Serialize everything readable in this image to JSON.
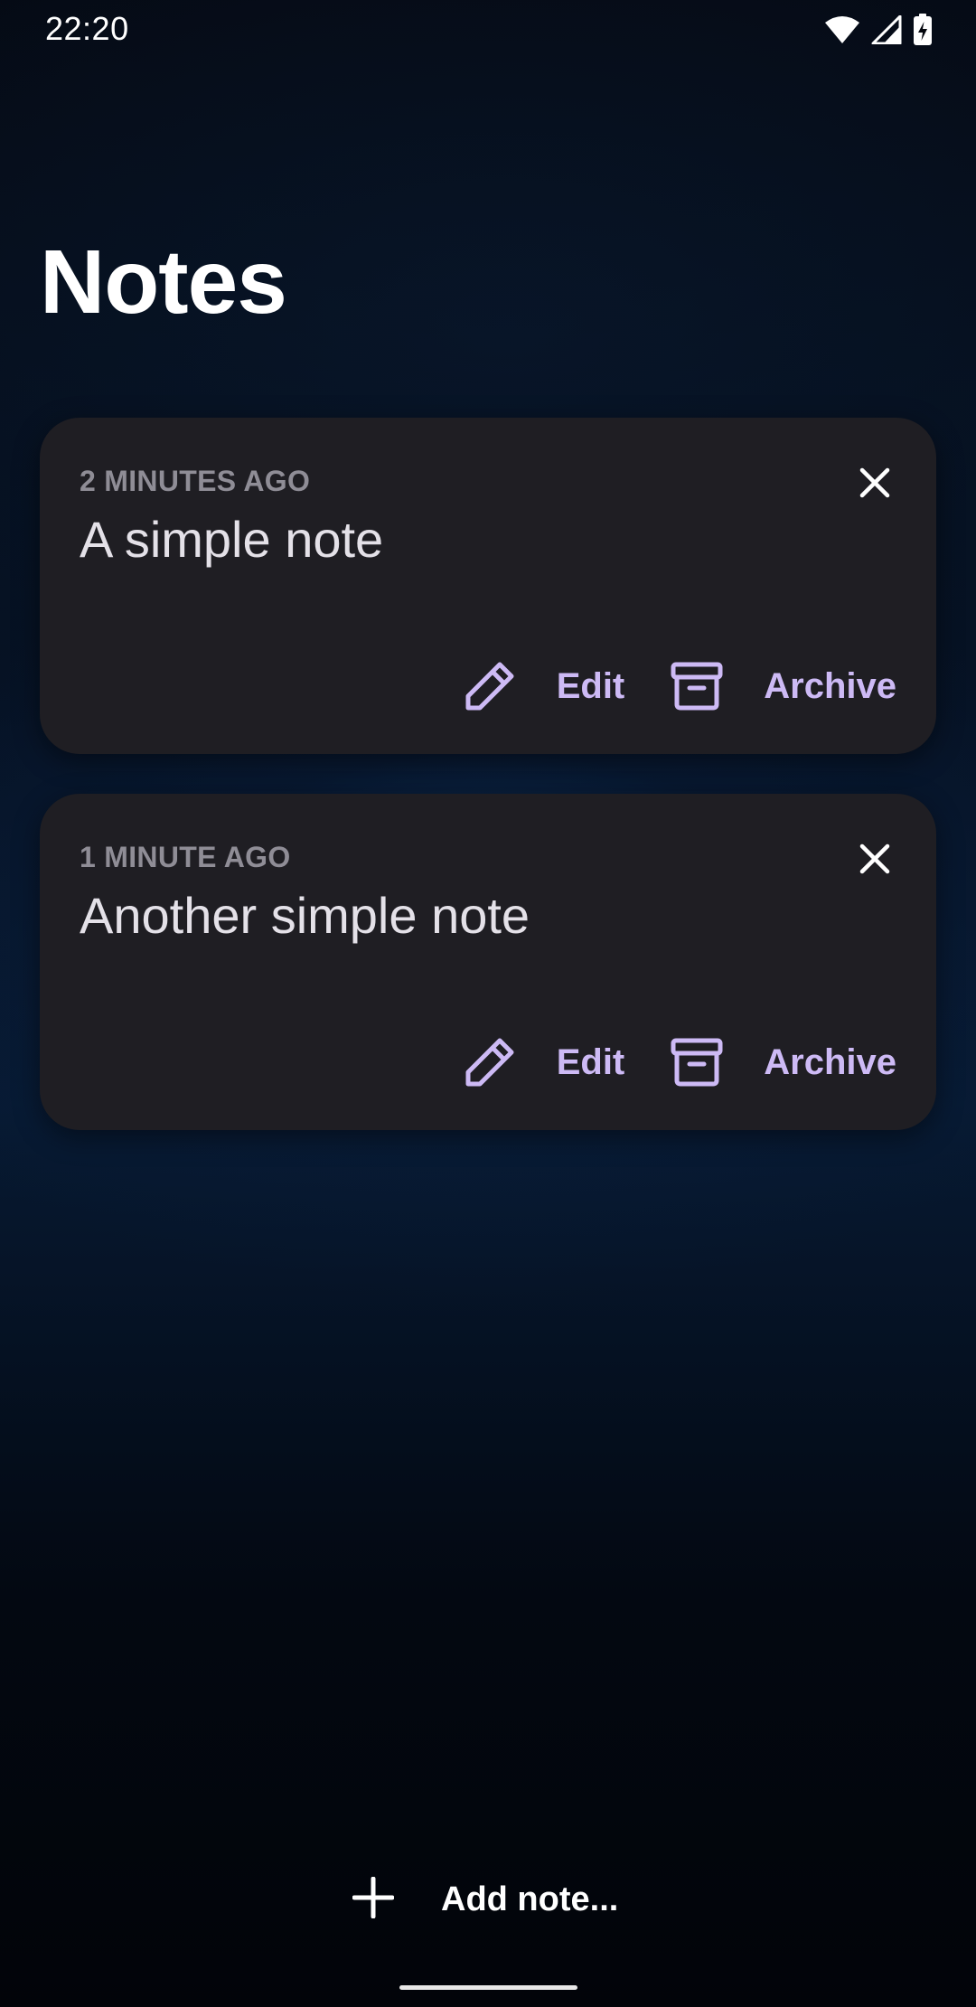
{
  "status_bar": {
    "time": "22:20",
    "icons": [
      "wifi-icon",
      "cellular-signal-icon",
      "battery-charging-icon"
    ]
  },
  "page": {
    "title": "Notes"
  },
  "notes": [
    {
      "timestamp": "2 MINUTES AGO",
      "text": "A simple note",
      "edit_label": "Edit",
      "archive_label": "Archive"
    },
    {
      "timestamp": "1 MINUTE AGO",
      "text": "Another simple note",
      "edit_label": "Edit",
      "archive_label": "Archive"
    }
  ],
  "add_note": {
    "label": "Add note..."
  },
  "colors": {
    "background": "#03060d",
    "card": "#1f1e23",
    "accent": "#cdbaf5",
    "timestamp": "#8f8d96",
    "note_text": "#e4e1e8"
  }
}
